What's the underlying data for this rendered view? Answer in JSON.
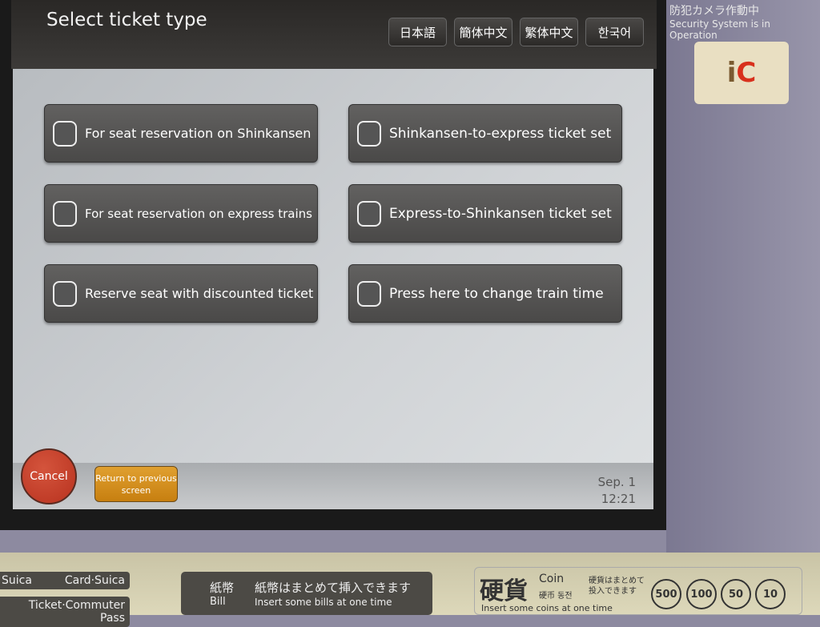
{
  "header": {
    "title": "Select ticket type",
    "languages": [
      "日本語",
      "簡体中文",
      "繁体中文",
      "한국어"
    ]
  },
  "buttons": [
    {
      "label": "For seat reservation on Shinkansen",
      "icon": "shinkansen-seat-icon"
    },
    {
      "label": "Shinkansen-to-express ticket set",
      "icon": "shinkansen-express-icon"
    },
    {
      "label": "For seat reservation on express trains",
      "icon": "express-seat-icon"
    },
    {
      "label": "Express-to-Shinkansen ticket set",
      "icon": "express-shinkansen-icon"
    },
    {
      "label": "Reserve seat with discounted ticket",
      "icon": "discount-ticket-icon"
    },
    {
      "label": "Press here to change train time",
      "icon": "change-time-icon"
    }
  ],
  "footer": {
    "cancel": "Cancel",
    "back": "Return to previous screen",
    "date": "Sep. 1",
    "time": "12:21"
  },
  "side": {
    "camera_jp": "防犯カメラ作動中",
    "camera_en": "Security System is in Operation",
    "ic_logo": "IC"
  },
  "panel": {
    "suica": "Suica",
    "card_suica": "Card·Suica",
    "ticket_pass": "Ticket·Commuter Pass",
    "bill_jp": "紙幣",
    "bill_en": "Bill",
    "bill_msg_jp": "紙幣はまとめて挿入できます",
    "bill_msg_en": "Insert some bills at one time",
    "coin_jp": "硬貨",
    "coin_en": "Coin",
    "coin_sub": "硬币 동전",
    "coin_msg_jp": "硬貨はまとめて投入できます",
    "coin_msg_en": "Insert some coins at one time",
    "coins": [
      "500",
      "100",
      "50",
      "10"
    ]
  },
  "colors": {
    "cancel": "#c0402a",
    "back": "#d48f20",
    "button": "#555453"
  }
}
